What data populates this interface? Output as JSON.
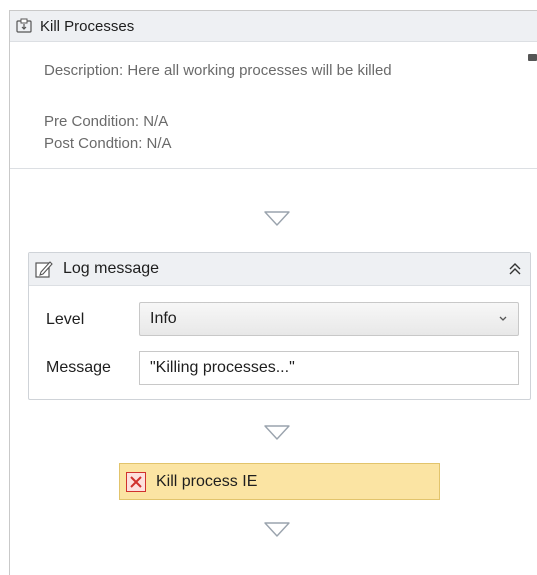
{
  "sequence": {
    "title": "Kill Processes",
    "icon": "sequence-icon",
    "annotation": {
      "description": "Description: Here all working processes will be killed",
      "pre_condition": "Pre Condition: N/A",
      "post_condition": "Post Condtion: N/A"
    }
  },
  "log_message": {
    "title": "Log message",
    "icon": "log-message-icon",
    "level_label": "Level",
    "level_value": "Info",
    "message_label": "Message",
    "message_value": "\"Killing processes...\""
  },
  "kill_process": {
    "title": "Kill process IE",
    "icon": "error-icon"
  },
  "colors": {
    "header_bg": "#eef0f3",
    "kill_bg": "#fbe4a3",
    "kill_border": "#e2c46c",
    "error_red": "#d0312d",
    "arrow": "#9aa3ad"
  }
}
